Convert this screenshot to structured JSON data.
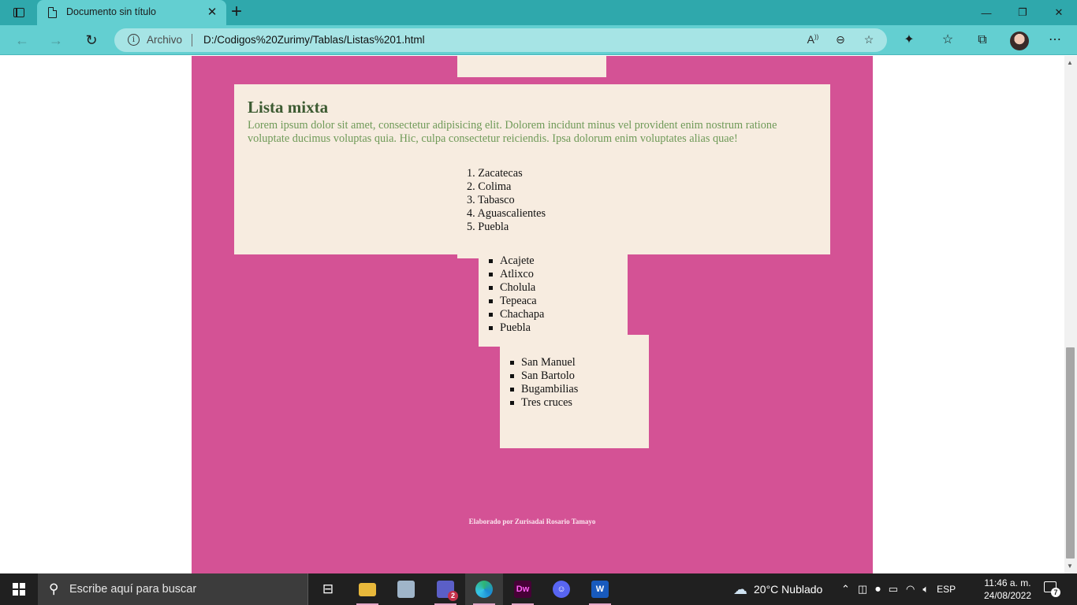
{
  "browser": {
    "tab_title": "Documento sin título",
    "tab_close": "✕",
    "new_tab": "+",
    "window": {
      "minimize": "—",
      "maximize": "❐",
      "close": "✕"
    },
    "address": {
      "scheme_label": "Archivo",
      "url": "D:/Codigos%20Zurimy/Tablas/Listas%201.html"
    },
    "nav": {
      "back": "←",
      "forward": "→",
      "reload": "↻"
    }
  },
  "page": {
    "section_title": "Lista mixta",
    "section_text": "Lorem ipsum dolor sit amet, consectetur adipisicing elit. Dolorem incidunt minus vel provident enim nostrum ratione voluptate ducimus voluptas quia. Hic, culpa consectetur reiciendis. Ipsa dolorum enim voluptates alias quae!",
    "ordered_list": [
      "1. Zacatecas",
      "2. Colima",
      "3. Tabasco",
      "4. Aguascalientes",
      "5. Puebla"
    ],
    "nested_list_1": [
      "Acajete",
      "Atlixco",
      "Cholula",
      "Tepeaca",
      "Chachapa",
      "Puebla"
    ],
    "nested_list_2": [
      "San Manuel",
      "San Bartolo",
      "Bugambilias",
      "Tres cruces"
    ],
    "footer": "Elaborado por Zurisadai Rosario Tamayo"
  },
  "taskbar": {
    "search_placeholder": "Escribe aquí para buscar",
    "teams_badge": "2",
    "dw_label": "Dw",
    "word_label": "W",
    "weather": "20°C  Nublado",
    "language": "ESP",
    "time": "11:46 a. m.",
    "date": "24/08/2022",
    "notifications": "7"
  },
  "colors": {
    "page_background": "#d45295",
    "box_background": "#f7ece0",
    "title_green": "#3d5b32",
    "text_green": "#6f9a58",
    "chrome_teal": "#2fa8ac"
  }
}
